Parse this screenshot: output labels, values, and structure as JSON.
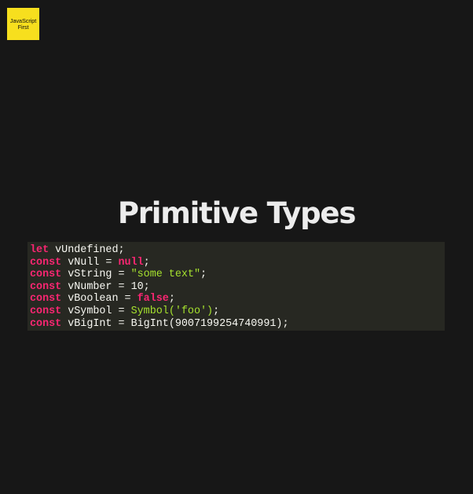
{
  "logo": {
    "line1": "JavaScript",
    "line2": "First",
    "color": "#f7df1e"
  },
  "title": "Primitive Types",
  "code": {
    "background": "#272822",
    "lines": [
      {
        "kw": "let",
        "rest": " vUndefined;"
      },
      {
        "kw": "const",
        "name": " vNull = ",
        "value": "null",
        "end": ";"
      },
      {
        "kw": "const",
        "name": " vString = ",
        "value": "\"some text\"",
        "end": ";"
      },
      {
        "kw": "const",
        "name": " vNumber = ",
        "value": "10",
        "end": ";"
      },
      {
        "kw": "const",
        "name": " vBoolean = ",
        "value": "false",
        "end": ";"
      },
      {
        "kw": "const",
        "name": " vSymbol = ",
        "fn": "Symbol",
        "arg": "('foo')",
        "end": ";"
      },
      {
        "kw": "const",
        "name": " vBigInt = ",
        "fn": "BigInt",
        "arg": "(9007199254740991)",
        "end": ";"
      }
    ]
  }
}
